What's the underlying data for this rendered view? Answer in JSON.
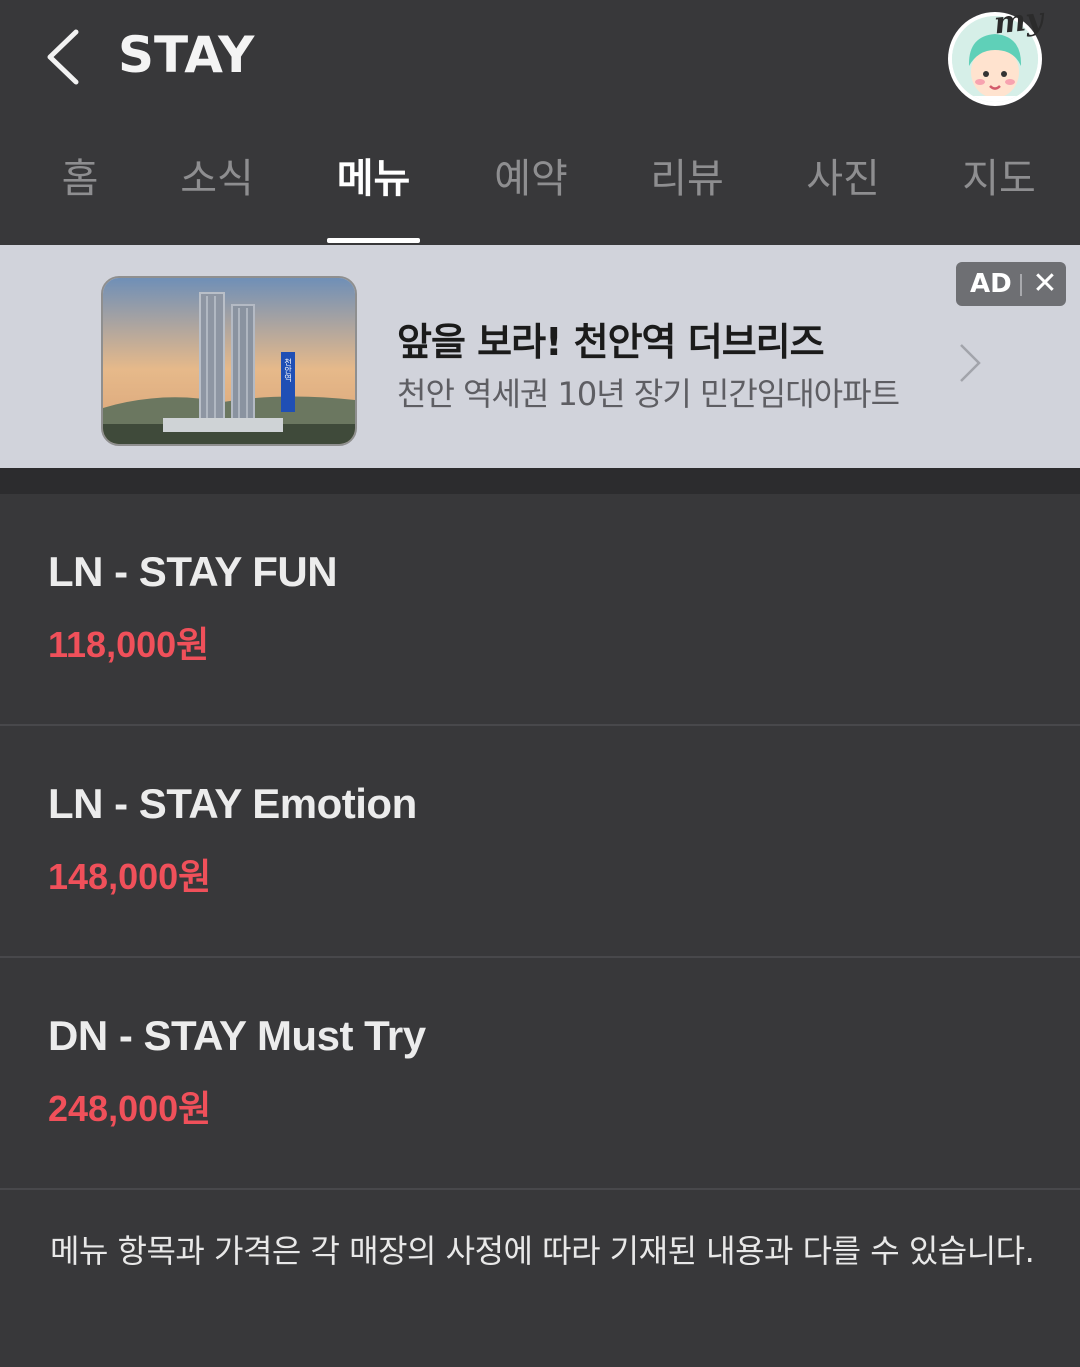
{
  "header": {
    "title": "STAY",
    "avatar_badge": "my"
  },
  "tabs": [
    {
      "label": "홈",
      "active": false
    },
    {
      "label": "소식",
      "active": false
    },
    {
      "label": "메뉴",
      "active": true
    },
    {
      "label": "예약",
      "active": false
    },
    {
      "label": "리뷰",
      "active": false
    },
    {
      "label": "사진",
      "active": false
    },
    {
      "label": "지도",
      "active": false
    }
  ],
  "ad": {
    "title": "앞을 보라! 천안역 더브리즈",
    "subtitle": "천안 역세권 10년 장기 민간임대아파트",
    "badge_label": "AD",
    "close_glyph": "✕",
    "image_sign_text": "천안역"
  },
  "menu": [
    {
      "name": "LN - STAY FUN",
      "price": "118,000원"
    },
    {
      "name": "LN - STAY Emotion",
      "price": "148,000원"
    },
    {
      "name": "DN - STAY Must Try",
      "price": "248,000원"
    }
  ],
  "notice": "메뉴 항목과 가격은 각 매장의 사정에 따라 기재된 내용과 다를 수 있습니다.",
  "colors": {
    "background": "#38383a",
    "price": "#f0505a",
    "ad_background": "#d1d3db",
    "active_tab": "#ffffff",
    "inactive_tab": "#8e8e90"
  }
}
